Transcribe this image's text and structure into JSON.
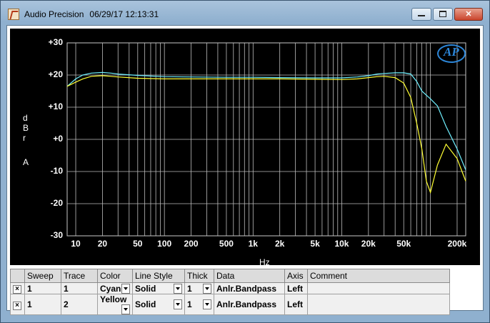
{
  "window": {
    "app_name": "Audio Precision",
    "datetime": "06/29/17 12:13:31",
    "colors": {
      "background": "#000000",
      "grid": "#c8c8c8",
      "cyan": "#6ff0ff",
      "yellow": "#ffff33"
    }
  },
  "chart_data": {
    "type": "line",
    "ylabel_chars": [
      "d",
      "B",
      "r",
      "",
      "A"
    ],
    "xlabel": "Hz",
    "xscale": "log",
    "xlim": [
      8,
      250000
    ],
    "ylim": [
      -30,
      30
    ],
    "y_ticks": [
      "+30",
      "+20",
      "+10",
      "+0",
      "-10",
      "-20",
      "-30"
    ],
    "y_tick_values": [
      30,
      20,
      10,
      0,
      -10,
      -20,
      -30
    ],
    "x_ticks": [
      "10",
      "20",
      "50",
      "100",
      "200",
      "500",
      "1k",
      "2k",
      "5k",
      "10k",
      "20k",
      "50k",
      "200k"
    ],
    "x_tick_values": [
      10,
      20,
      50,
      100,
      200,
      500,
      1000,
      2000,
      5000,
      10000,
      20000,
      50000,
      200000
    ],
    "grid": true,
    "series": [
      {
        "color": "#6ff0ff",
        "x": [
          8,
          10,
          12,
          15,
          20,
          25,
          30,
          50,
          100,
          200,
          500,
          1000,
          2000,
          5000,
          10000,
          15000,
          20000,
          25000,
          30000,
          40000,
          50000,
          60000,
          70000,
          80000,
          100000,
          120000,
          150000,
          200000,
          250000
        ],
        "y": [
          16.5,
          18.8,
          20,
          20.6,
          20.8,
          20.6,
          20.3,
          19.9,
          19.5,
          19.4,
          19.3,
          19.3,
          19.2,
          19.1,
          19.1,
          19.4,
          19.8,
          20.3,
          20.5,
          20.7,
          20.7,
          20.3,
          18,
          15,
          12.6,
          10.4,
          4,
          -3,
          -9.5
        ]
      },
      {
        "color": "#ffff33",
        "x": [
          8,
          10,
          12,
          15,
          20,
          25,
          30,
          50,
          100,
          200,
          500,
          1000,
          2000,
          5000,
          10000,
          15000,
          20000,
          25000,
          30000,
          40000,
          50000,
          60000,
          70000,
          80000,
          90000,
          100000,
          120000,
          150000,
          200000,
          250000
        ],
        "y": [
          16.5,
          17.8,
          18.8,
          19.6,
          19.8,
          19.6,
          19.4,
          19,
          18.8,
          18.8,
          18.8,
          18.8,
          18.8,
          18.7,
          18.6,
          18.8,
          19.2,
          19.5,
          19.6,
          19.2,
          17.5,
          13,
          5,
          -3,
          -13,
          -16.5,
          -8,
          -1.5,
          -6,
          -13
        ]
      }
    ]
  },
  "table": {
    "headers": [
      "",
      "Sweep",
      "Trace",
      "Color",
      "Line Style",
      "Thick",
      "Data",
      "Axis",
      "Comment"
    ],
    "rows": [
      {
        "checked": "×",
        "sweep": "1",
        "trace": "1",
        "color": "Cyan",
        "style": "Solid",
        "thick": "1",
        "data": "Anlr.Bandpass",
        "axis": "Left",
        "comment": ""
      },
      {
        "checked": "×",
        "sweep": "1",
        "trace": "2",
        "color": "Yellow",
        "style": "Solid",
        "thick": "1",
        "data": "Anlr.Bandpass",
        "axis": "Left",
        "comment": ""
      }
    ]
  },
  "logo_text": "AP"
}
